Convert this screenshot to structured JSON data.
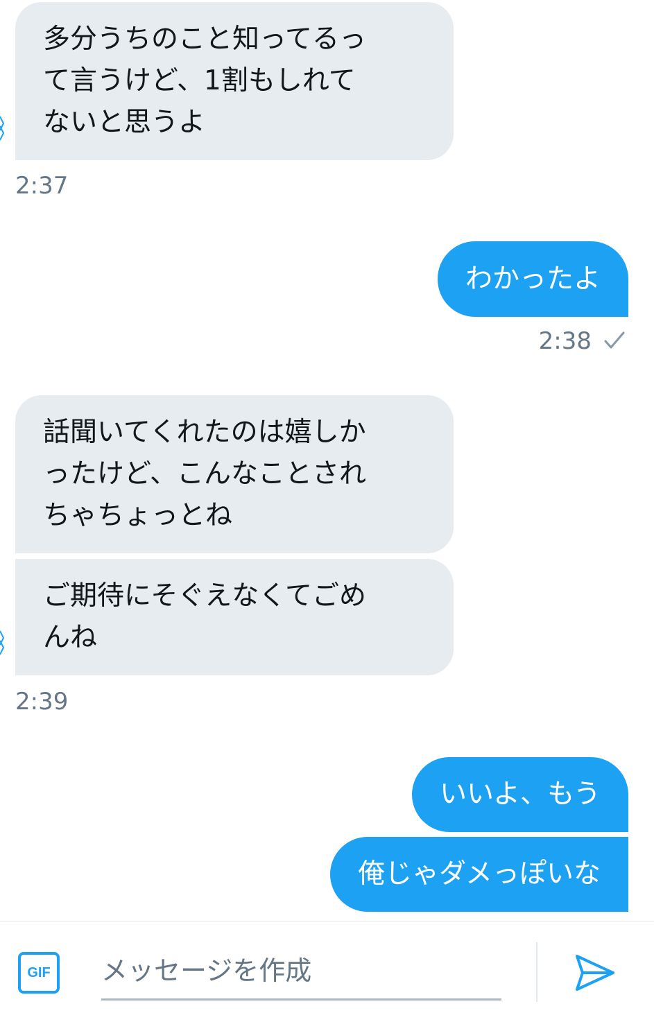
{
  "messages": [
    {
      "direction": "in",
      "text": "多分うちのこと知ってるっ\nて言うけど、1割もしれて\nないと思うよ"
    },
    {
      "direction": "out",
      "text": "わかったよ"
    },
    {
      "direction": "in",
      "text": "話聞いてくれたのは嬉しか\nったけど、こんなことされ\nちゃちょっとね"
    },
    {
      "direction": "in",
      "text": "ご期待にそぐえなくてごめ\nんね"
    },
    {
      "direction": "out",
      "text": "いいよ、もう"
    },
    {
      "direction": "out",
      "text": "俺じゃダメっぽいな"
    }
  ],
  "timestamps": {
    "t1": "2:37",
    "t2": "2:38",
    "t3": "2:39"
  },
  "composer": {
    "gif_label": "GIF",
    "placeholder": "メッセージを作成",
    "value": ""
  },
  "icons": {
    "read_receipt": "checkmark-icon",
    "send": "send-icon"
  },
  "colors": {
    "accent": "#1da1f2",
    "incoming_bubble": "#e6ecf0",
    "timestamp": "#657786"
  }
}
